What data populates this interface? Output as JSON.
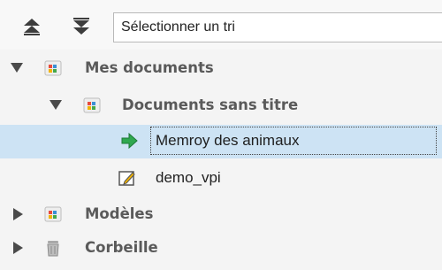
{
  "toolbar": {
    "sort_up_icon": "double-chevron-up-icon",
    "sort_down_icon": "double-chevron-down-icon",
    "sort_select_value": "Sélectionner un tri"
  },
  "tree": {
    "items": [
      {
        "label": "Mes documents",
        "icon": "library-icon",
        "expanded": true
      },
      {
        "label": "Documents sans titre",
        "icon": "library-icon",
        "expanded": true
      },
      {
        "label": "Memroy des animaux",
        "icon": "green-arrow-icon",
        "selected": true
      },
      {
        "label": "demo_vpi",
        "icon": "edit-document-icon"
      },
      {
        "label": "Modèles",
        "icon": "library-icon",
        "expanded": false
      },
      {
        "label": "Corbeille",
        "icon": "trash-icon",
        "expanded": false
      }
    ]
  },
  "colors": {
    "selection": "#cde3f4",
    "arrow_green": "#2fa84f",
    "text_gray": "#555555"
  }
}
